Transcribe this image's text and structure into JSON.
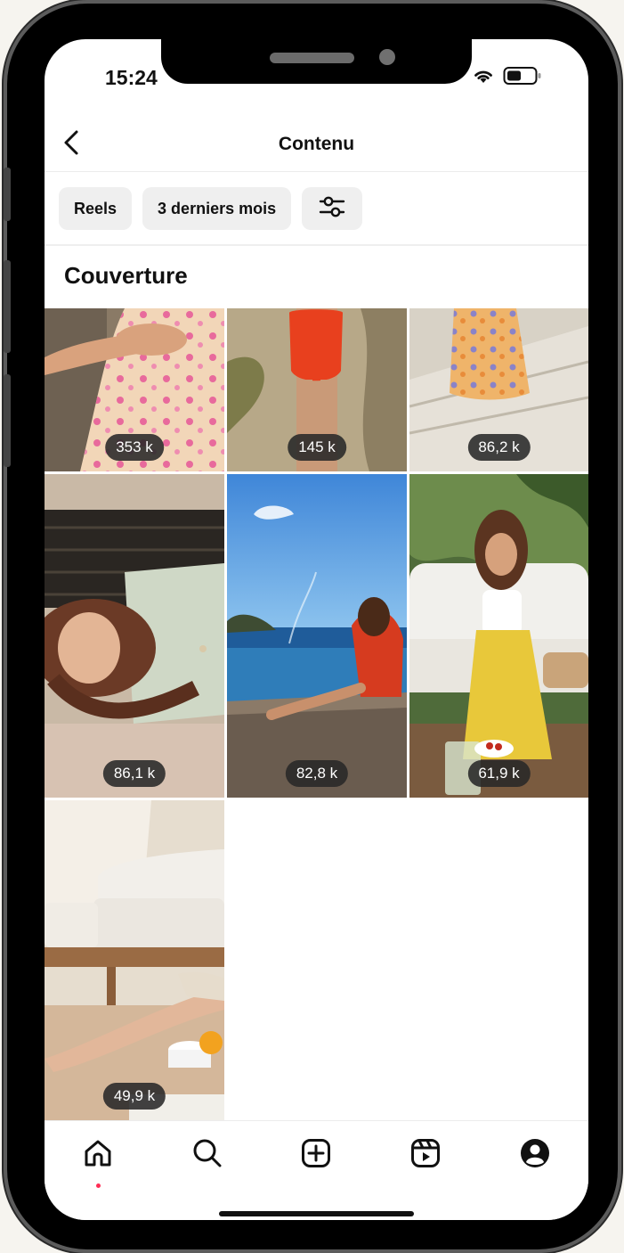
{
  "status_bar": {
    "time": "15:24",
    "icons": [
      "wifi-icon",
      "battery-icon"
    ]
  },
  "header": {
    "title": "Contenu",
    "back_icon": "chevron-left-icon"
  },
  "filters": [
    {
      "label": "Reels"
    },
    {
      "label": "3 derniers mois"
    },
    {
      "icon": "sliders-icon"
    }
  ],
  "section": {
    "title": "Couverture"
  },
  "posts": [
    {
      "views": "353 k"
    },
    {
      "views": "145 k"
    },
    {
      "views": "86,2 k"
    },
    {
      "views": "86,1 k"
    },
    {
      "views": "82,8 k"
    },
    {
      "views": "61,9 k"
    },
    {
      "views": "49,9 k"
    }
  ],
  "tab_bar": {
    "tabs": [
      "home-icon",
      "search-icon",
      "create-icon",
      "reels-icon",
      "profile-icon"
    ],
    "active": "home-icon",
    "activity_dot_color": "#ff2d55"
  }
}
